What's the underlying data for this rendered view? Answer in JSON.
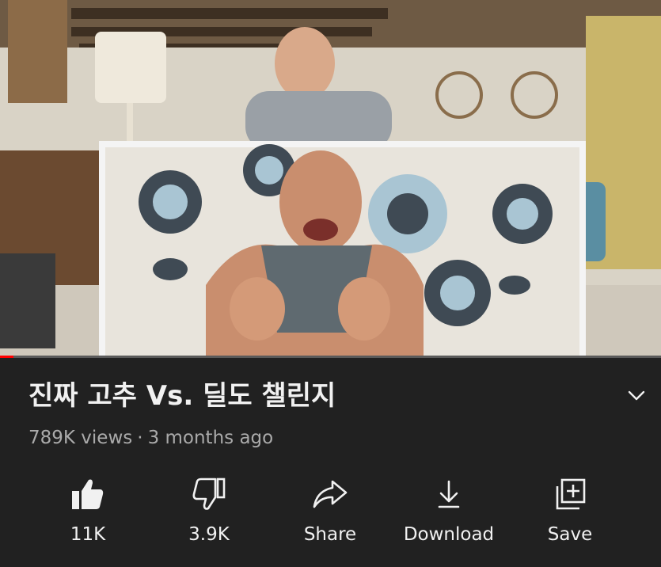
{
  "video": {
    "progress_fraction": 0.02
  },
  "title": "진짜 고추 Vs. 딜도 챌린지",
  "meta": {
    "views": "789K views",
    "separator": "·",
    "age": "3 months ago"
  },
  "actions": {
    "like_label": "11K",
    "dislike_label": "3.9K",
    "share_label": "Share",
    "download_label": "Download",
    "save_label": "Save"
  },
  "icons": {
    "expand": "chevron-down-icon",
    "like": "thumbs-up-icon",
    "dislike": "thumbs-down-icon",
    "share": "share-arrow-icon",
    "download": "download-icon",
    "save": "playlist-add-icon"
  },
  "colors": {
    "background": "#212121",
    "text_primary": "#f1f1f1",
    "text_secondary": "#aaaaaa",
    "progress": "#ff0000"
  }
}
